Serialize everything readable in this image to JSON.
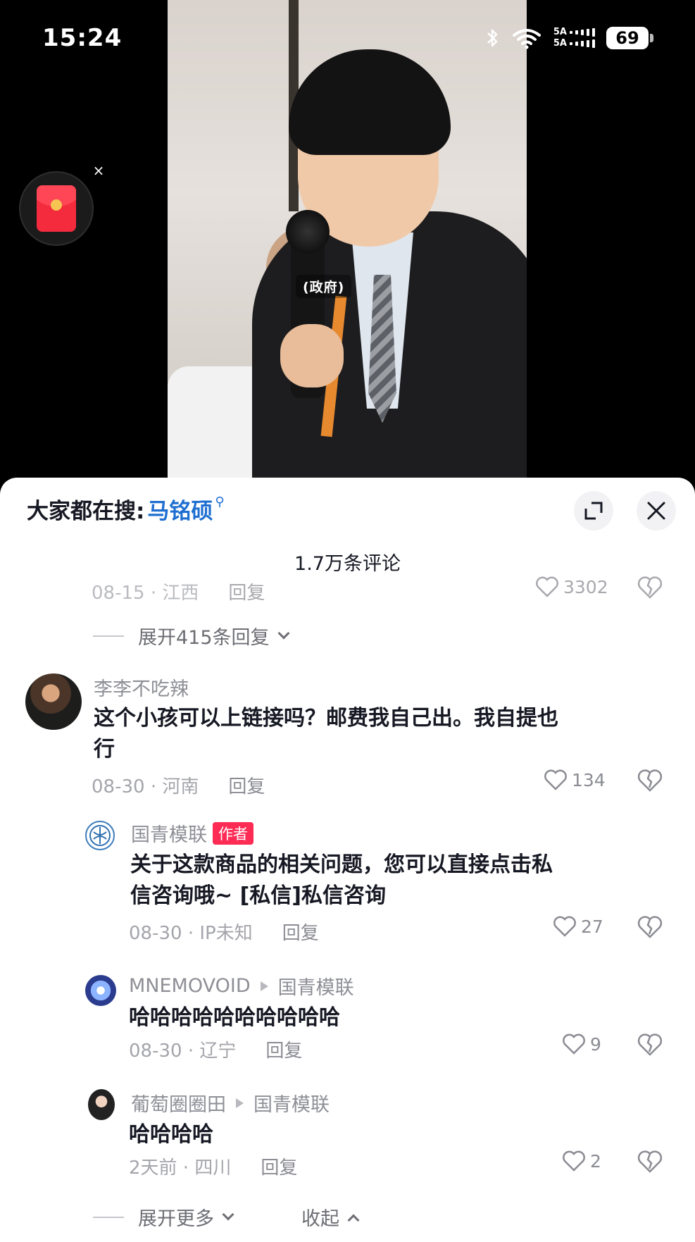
{
  "status_bar": {
    "time": "15:24",
    "network_top": "5A",
    "network_bottom": "5A",
    "battery": "69"
  },
  "video": {
    "caption": "(政府)"
  },
  "comment_sheet": {
    "search_prefix": "大家都在搜:",
    "search_term": "马铭硕",
    "comment_count": "1.7万条评论",
    "partial_comment": {
      "date_location": "08-15 · 江西",
      "reply_label": "回复",
      "likes": "3302"
    },
    "expand_replies": "展开415条回复",
    "comments": [
      {
        "username": "李李不吃辣",
        "text_line1": "这个小孩可以上链接吗？邮费我自己出。我自提也",
        "text_line2": "行",
        "date_location": "08-30 · 河南",
        "reply_label": "回复",
        "likes": "134"
      }
    ],
    "replies": [
      {
        "username": "国青模联",
        "tag": "作者",
        "text_line1": "关于这款商品的相关问题，您可以直接点击私",
        "text_line2": "信咨询哦~ [私信]私信咨询",
        "date_location": "08-30 · IP未知",
        "reply_label": "回复",
        "likes": "27"
      },
      {
        "username": "MNEMOVOID",
        "reply_to": "国青模联",
        "text": "哈哈哈哈哈哈哈哈哈哈",
        "date_location": "08-30 · 辽宁",
        "reply_label": "回复",
        "likes": "9"
      },
      {
        "username": "葡萄圈圈田",
        "reply_to": "国青模联",
        "text": "哈哈哈哈",
        "date_location": "2天前 · 四川",
        "reply_label": "回复",
        "likes": "2"
      }
    ],
    "expand_more": "展开更多",
    "collapse": "收起"
  }
}
